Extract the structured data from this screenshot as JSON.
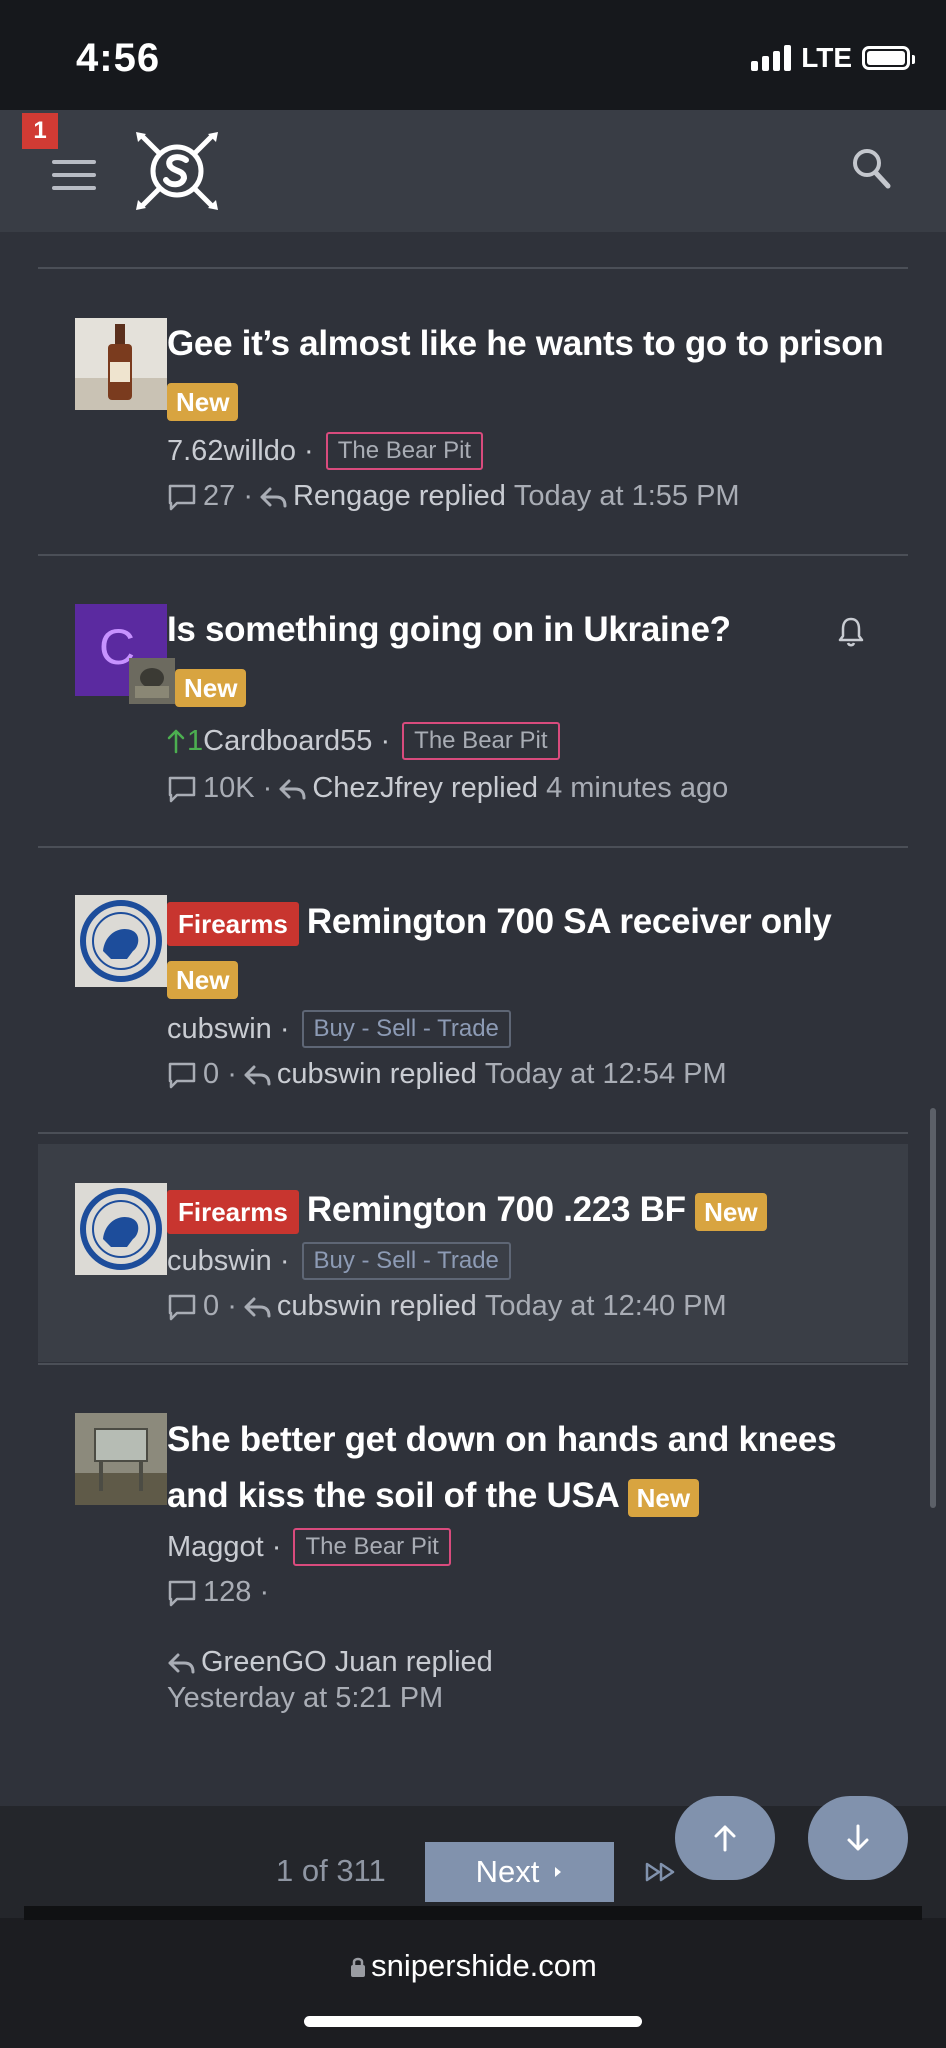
{
  "status": {
    "time": "4:56",
    "network": "LTE"
  },
  "header": {
    "alert_count": "1"
  },
  "threads": [
    {
      "title": "Gee it’s almost like he wants to go to prison",
      "badge": "New",
      "author": "7.62willdo",
      "forum": "The Bear Pit",
      "replies": "27",
      "last_user": "Rengage",
      "replied_word": "replied",
      "time": "Today at 1:55 PM"
    },
    {
      "title": "Is something going on in Ukraine?",
      "badge": "New",
      "avatar_letter": "C",
      "vote": "1",
      "author": "Cardboard55",
      "forum": "The Bear Pit",
      "replies": "10K",
      "last_user": "ChezJfrey",
      "replied_word": "replied",
      "time": "4 minutes ago"
    },
    {
      "prefix": "Firearms",
      "title": "Remington 700 SA receiver only",
      "badge": "New",
      "author": "cubswin",
      "forum": "Buy - Sell - Trade",
      "replies": "0",
      "last_user": "cubswin",
      "replied_word": "replied",
      "time": "Today at 12:54 PM"
    },
    {
      "prefix": "Firearms",
      "title": "Remington 700 .223 BF",
      "badge": "New",
      "author": "cubswin",
      "forum": "Buy - Sell - Trade",
      "replies": "0",
      "last_user": "cubswin",
      "replied_word": "replied",
      "time": "Today at 12:40 PM"
    },
    {
      "title": "She better get down on hands and knees and kiss the soil of the USA",
      "badge": "New",
      "author": "Maggot",
      "forum": "The Bear Pit",
      "replies": "128",
      "last_user": "GreenGO Juan",
      "replied_word": "replied",
      "time": "Yesterday at 5:21 PM"
    }
  ],
  "pagination": {
    "info": "1 of 311",
    "next_label": "Next"
  },
  "browser": {
    "url": "snipershide.com"
  },
  "colors": {
    "accent": "#8192ad",
    "new_badge": "#d8a440",
    "prefix": "#c8352f",
    "tag_pink": "#d94b7d"
  }
}
